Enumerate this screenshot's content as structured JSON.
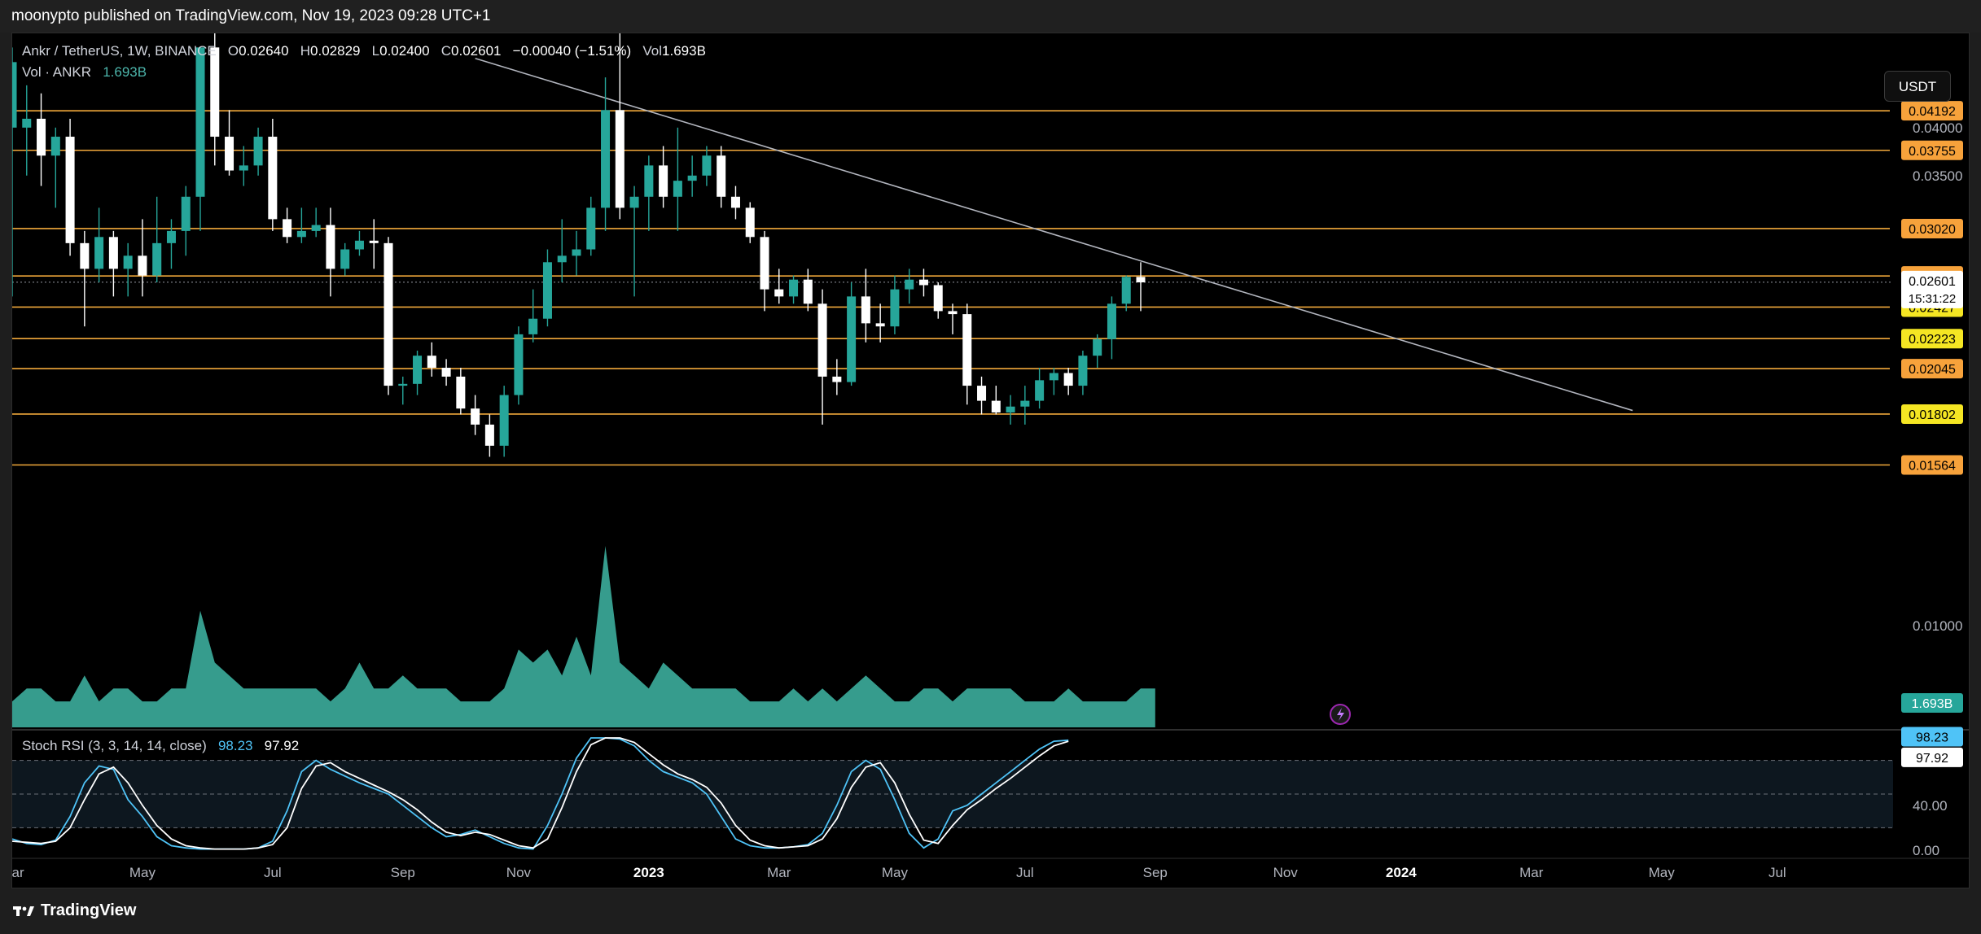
{
  "header": {
    "published_text": "moonypto published on TradingView.com, Nov 19, 2023 09:28 UTC+1"
  },
  "legend": {
    "symbol": "Ankr / TetherUS, 1W, BINANCE",
    "o_label": "O",
    "o_value": "0.02640",
    "h_label": "H",
    "h_value": "0.02829",
    "l_label": "L",
    "l_value": "0.02400",
    "c_label": "C",
    "c_value": "0.02601",
    "change": "−0.00040 (−1.51%)",
    "vol_label": "Vol",
    "vol_value": "1.693B",
    "vol_series_label": "Vol · ANKR",
    "vol_series_value": "1.693B",
    "stoch_label": "Stoch RSI (3, 3, 14, 14, close)",
    "stoch_k": "98.23",
    "stoch_d": "97.92"
  },
  "unit_button": "USDT",
  "footer": {
    "brand": "TradingView"
  },
  "colors": {
    "up": "#26a69a",
    "down": "#ffffff",
    "level_line": "#f2a93b",
    "label_orange": "#f7a23b",
    "label_yellow": "#f5e623",
    "trendline": "#b2b5be",
    "stoch_k": "#4fc3f7",
    "stoch_d": "#ffffff",
    "background": "#000000"
  },
  "chart_data": [
    {
      "type": "candlestick",
      "title": "Ankr / TetherUS, 1W, BINANCE",
      "y_scale": "log",
      "ylim": [
        0.0075,
        0.052
      ],
      "x_range_weeks": [
        -44,
        86
      ],
      "time_axis_labels": [
        "Mar",
        "May",
        "Jul",
        "Sep",
        "Nov",
        "2023",
        "Mar",
        "May",
        "Jul",
        "Sep",
        "Nov",
        "2024",
        "Mar",
        "May",
        "Jul"
      ],
      "time_axis_label_week": [
        -44,
        -35,
        -26,
        -17,
        -9,
        0,
        9,
        17,
        26,
        35,
        44,
        52,
        61,
        70,
        78
      ],
      "price_tick_labels": [
        "0.04000",
        "0.03500",
        "0.01000"
      ],
      "price_tick_values": [
        0.04,
        0.035,
        0.01
      ],
      "last_price": "0.02601",
      "countdown": "15:31:22",
      "horizontal_levels": [
        {
          "value": 0.04192,
          "label": "0.04192",
          "style": "orange"
        },
        {
          "value": 0.03755,
          "label": "0.03755",
          "style": "orange"
        },
        {
          "value": 0.0302,
          "label": "0.03020",
          "style": "orange"
        },
        {
          "value": 0.02647,
          "label": "0.02647",
          "style": "orange"
        },
        {
          "value": 0.02427,
          "label": "0.02427",
          "style": "yellow"
        },
        {
          "value": 0.02223,
          "label": "0.02223",
          "style": "yellow"
        },
        {
          "value": 0.02045,
          "label": "0.02045",
          "style": "orange"
        },
        {
          "value": 0.01802,
          "label": "0.01802",
          "style": "yellow"
        },
        {
          "value": 0.01564,
          "label": "0.01564",
          "style": "orange"
        }
      ],
      "trendline": {
        "from": {
          "week": -12,
          "price": 0.0485
        },
        "to": {
          "week": 68,
          "price": 0.0182
        }
      },
      "candles": [
        {
          "w": -44,
          "o": 0.04,
          "h": 0.05,
          "l": 0.025,
          "c": 0.048
        },
        {
          "w": -43,
          "o": 0.04,
          "h": 0.045,
          "l": 0.035,
          "c": 0.041
        },
        {
          "w": -42,
          "o": 0.041,
          "h": 0.044,
          "l": 0.034,
          "c": 0.037
        },
        {
          "w": -41,
          "o": 0.037,
          "h": 0.04,
          "l": 0.032,
          "c": 0.039
        },
        {
          "w": -40,
          "o": 0.039,
          "h": 0.041,
          "l": 0.028,
          "c": 0.029
        },
        {
          "w": -39,
          "o": 0.029,
          "h": 0.03,
          "l": 0.023,
          "c": 0.027
        },
        {
          "w": -38,
          "o": 0.027,
          "h": 0.032,
          "l": 0.026,
          "c": 0.0295
        },
        {
          "w": -37,
          "o": 0.0295,
          "h": 0.03,
          "l": 0.025,
          "c": 0.027
        },
        {
          "w": -36,
          "o": 0.027,
          "h": 0.029,
          "l": 0.025,
          "c": 0.028
        },
        {
          "w": -35,
          "o": 0.028,
          "h": 0.031,
          "l": 0.025,
          "c": 0.0265
        },
        {
          "w": -34,
          "o": 0.0265,
          "h": 0.033,
          "l": 0.026,
          "c": 0.029
        },
        {
          "w": -33,
          "o": 0.029,
          "h": 0.031,
          "l": 0.027,
          "c": 0.03
        },
        {
          "w": -32,
          "o": 0.03,
          "h": 0.034,
          "l": 0.028,
          "c": 0.033
        },
        {
          "w": -31,
          "o": 0.033,
          "h": 0.05,
          "l": 0.03,
          "c": 0.05
        },
        {
          "w": -30,
          "o": 0.05,
          "h": 0.052,
          "l": 0.036,
          "c": 0.039
        },
        {
          "w": -29,
          "o": 0.039,
          "h": 0.042,
          "l": 0.035,
          "c": 0.0355
        },
        {
          "w": -28,
          "o": 0.0355,
          "h": 0.038,
          "l": 0.034,
          "c": 0.036
        },
        {
          "w": -27,
          "o": 0.036,
          "h": 0.04,
          "l": 0.035,
          "c": 0.039
        },
        {
          "w": -26,
          "o": 0.039,
          "h": 0.041,
          "l": 0.03,
          "c": 0.031
        },
        {
          "w": -25,
          "o": 0.031,
          "h": 0.032,
          "l": 0.029,
          "c": 0.0295
        },
        {
          "w": -24,
          "o": 0.0295,
          "h": 0.032,
          "l": 0.029,
          "c": 0.03
        },
        {
          "w": -23,
          "o": 0.03,
          "h": 0.032,
          "l": 0.0295,
          "c": 0.0305
        },
        {
          "w": -22,
          "o": 0.0305,
          "h": 0.032,
          "l": 0.025,
          "c": 0.027
        },
        {
          "w": -21,
          "o": 0.027,
          "h": 0.029,
          "l": 0.0265,
          "c": 0.0285
        },
        {
          "w": -20,
          "o": 0.0285,
          "h": 0.03,
          "l": 0.028,
          "c": 0.0292
        },
        {
          "w": -19,
          "o": 0.0292,
          "h": 0.031,
          "l": 0.027,
          "c": 0.029
        },
        {
          "w": -18,
          "o": 0.029,
          "h": 0.0295,
          "l": 0.019,
          "c": 0.0195
        },
        {
          "w": -17,
          "o": 0.0195,
          "h": 0.02,
          "l": 0.0185,
          "c": 0.0196
        },
        {
          "w": -16,
          "o": 0.0196,
          "h": 0.0215,
          "l": 0.019,
          "c": 0.0212
        },
        {
          "w": -15,
          "o": 0.0212,
          "h": 0.022,
          "l": 0.02,
          "c": 0.0205
        },
        {
          "w": -14,
          "o": 0.0205,
          "h": 0.021,
          "l": 0.0195,
          "c": 0.02
        },
        {
          "w": -13,
          "o": 0.02,
          "h": 0.0205,
          "l": 0.018,
          "c": 0.0183
        },
        {
          "w": -12,
          "o": 0.0183,
          "h": 0.019,
          "l": 0.017,
          "c": 0.0175
        },
        {
          "w": -11,
          "o": 0.0175,
          "h": 0.018,
          "l": 0.016,
          "c": 0.0165
        },
        {
          "w": -10,
          "o": 0.0165,
          "h": 0.0195,
          "l": 0.016,
          "c": 0.019
        },
        {
          "w": -9,
          "o": 0.019,
          "h": 0.023,
          "l": 0.0185,
          "c": 0.0225
        },
        {
          "w": -8,
          "o": 0.0225,
          "h": 0.0255,
          "l": 0.022,
          "c": 0.0235
        },
        {
          "w": -7,
          "o": 0.0235,
          "h": 0.0285,
          "l": 0.023,
          "c": 0.0275
        },
        {
          "w": -6,
          "o": 0.0275,
          "h": 0.031,
          "l": 0.026,
          "c": 0.028
        },
        {
          "w": -5,
          "o": 0.028,
          "h": 0.03,
          "l": 0.0265,
          "c": 0.0285
        },
        {
          "w": -4,
          "o": 0.0285,
          "h": 0.033,
          "l": 0.028,
          "c": 0.032
        },
        {
          "w": -3,
          "o": 0.032,
          "h": 0.046,
          "l": 0.03,
          "c": 0.042
        },
        {
          "w": -2,
          "o": 0.042,
          "h": 0.052,
          "l": 0.031,
          "c": 0.032
        },
        {
          "w": -1,
          "o": 0.032,
          "h": 0.034,
          "l": 0.025,
          "c": 0.033
        },
        {
          "w": 0,
          "o": 0.033,
          "h": 0.037,
          "l": 0.03,
          "c": 0.036
        },
        {
          "w": 1,
          "o": 0.036,
          "h": 0.038,
          "l": 0.032,
          "c": 0.033
        },
        {
          "w": 2,
          "o": 0.033,
          "h": 0.04,
          "l": 0.03,
          "c": 0.0345
        },
        {
          "w": 3,
          "o": 0.0345,
          "h": 0.037,
          "l": 0.033,
          "c": 0.035
        },
        {
          "w": 4,
          "o": 0.035,
          "h": 0.038,
          "l": 0.034,
          "c": 0.037
        },
        {
          "w": 5,
          "o": 0.037,
          "h": 0.038,
          "l": 0.032,
          "c": 0.033
        },
        {
          "w": 6,
          "o": 0.033,
          "h": 0.034,
          "l": 0.031,
          "c": 0.032
        },
        {
          "w": 7,
          "o": 0.032,
          "h": 0.0325,
          "l": 0.029,
          "c": 0.0295
        },
        {
          "w": 8,
          "o": 0.0295,
          "h": 0.03,
          "l": 0.024,
          "c": 0.0255
        },
        {
          "w": 9,
          "o": 0.0255,
          "h": 0.027,
          "l": 0.0245,
          "c": 0.025
        },
        {
          "w": 10,
          "o": 0.025,
          "h": 0.0265,
          "l": 0.0245,
          "c": 0.0262
        },
        {
          "w": 11,
          "o": 0.0262,
          "h": 0.027,
          "l": 0.024,
          "c": 0.0245
        },
        {
          "w": 12,
          "o": 0.0245,
          "h": 0.0255,
          "l": 0.0175,
          "c": 0.02
        },
        {
          "w": 13,
          "o": 0.02,
          "h": 0.021,
          "l": 0.019,
          "c": 0.0197
        },
        {
          "w": 14,
          "o": 0.0197,
          "h": 0.026,
          "l": 0.0195,
          "c": 0.025
        },
        {
          "w": 15,
          "o": 0.025,
          "h": 0.027,
          "l": 0.022,
          "c": 0.0232
        },
        {
          "w": 16,
          "o": 0.0232,
          "h": 0.0245,
          "l": 0.022,
          "c": 0.023
        },
        {
          "w": 17,
          "o": 0.023,
          "h": 0.0265,
          "l": 0.0225,
          "c": 0.0255
        },
        {
          "w": 18,
          "o": 0.0255,
          "h": 0.027,
          "l": 0.0245,
          "c": 0.0262
        },
        {
          "w": 19,
          "o": 0.0262,
          "h": 0.027,
          "l": 0.025,
          "c": 0.0258
        },
        {
          "w": 20,
          "o": 0.0258,
          "h": 0.026,
          "l": 0.0235,
          "c": 0.024
        },
        {
          "w": 21,
          "o": 0.024,
          "h": 0.0245,
          "l": 0.0225,
          "c": 0.0238
        },
        {
          "w": 22,
          "o": 0.0238,
          "h": 0.0245,
          "l": 0.0185,
          "c": 0.0195
        },
        {
          "w": 23,
          "o": 0.0195,
          "h": 0.02,
          "l": 0.018,
          "c": 0.0187
        },
        {
          "w": 24,
          "o": 0.0187,
          "h": 0.0195,
          "l": 0.018,
          "c": 0.0181
        },
        {
          "w": 25,
          "o": 0.0181,
          "h": 0.019,
          "l": 0.0175,
          "c": 0.0184
        },
        {
          "w": 26,
          "o": 0.0184,
          "h": 0.0195,
          "l": 0.0175,
          "c": 0.0187
        },
        {
          "w": 27,
          "o": 0.0187,
          "h": 0.0205,
          "l": 0.0183,
          "c": 0.0198
        },
        {
          "w": 28,
          "o": 0.0198,
          "h": 0.0205,
          "l": 0.019,
          "c": 0.0202
        },
        {
          "w": 29,
          "o": 0.0202,
          "h": 0.0205,
          "l": 0.019,
          "c": 0.0195
        },
        {
          "w": 30,
          "o": 0.0195,
          "h": 0.0215,
          "l": 0.019,
          "c": 0.0212
        },
        {
          "w": 31,
          "o": 0.0212,
          "h": 0.0225,
          "l": 0.0205,
          "c": 0.0222
        },
        {
          "w": 32,
          "o": 0.0222,
          "h": 0.025,
          "l": 0.021,
          "c": 0.0245
        },
        {
          "w": 33,
          "o": 0.0245,
          "h": 0.0265,
          "l": 0.024,
          "c": 0.0264
        },
        {
          "w": 34,
          "o": 0.0264,
          "h": 0.0275,
          "l": 0.024,
          "c": 0.026
        }
      ],
      "volume": {
        "label": "Vol · ANKR",
        "last": "1.693B",
        "values": [
          2,
          3,
          3,
          2,
          2,
          4,
          2,
          3,
          3,
          2,
          2,
          3,
          3,
          9,
          5,
          4,
          3,
          3,
          3,
          3,
          3,
          3,
          2,
          3,
          5,
          3,
          3,
          4,
          3,
          3,
          3,
          2,
          2,
          2,
          3,
          6,
          5,
          6,
          4,
          7,
          4,
          14,
          5,
          4,
          3,
          5,
          4,
          3,
          3,
          3,
          3,
          2,
          2,
          2,
          3,
          2,
          3,
          2,
          3,
          4,
          3,
          2,
          2,
          3,
          3,
          2,
          3,
          3,
          3,
          3,
          2,
          2,
          2,
          3,
          2,
          2,
          2,
          2,
          3,
          3
        ]
      },
      "stoch_rsi": {
        "label": "Stoch RSI (3, 3, 14, 14, close)",
        "k_last": "98.23",
        "d_last": "97.92",
        "axis_labels": [
          "40.00",
          "0.00"
        ],
        "bands": [
          80,
          50,
          20
        ],
        "k": [
          10,
          6,
          5,
          9,
          30,
          60,
          75,
          72,
          45,
          30,
          12,
          4,
          2,
          1,
          1,
          1,
          1,
          2,
          8,
          35,
          70,
          80,
          72,
          66,
          60,
          55,
          50,
          40,
          30,
          20,
          12,
          14,
          18,
          12,
          6,
          2,
          1,
          22,
          50,
          82,
          100,
          100,
          99,
          93,
          80,
          70,
          65,
          60,
          50,
          30,
          10,
          4,
          2,
          2,
          3,
          5,
          15,
          40,
          70,
          80,
          72,
          45,
          15,
          2,
          10,
          35,
          40,
          50,
          60,
          70,
          80,
          90,
          97,
          98
        ],
        "d": [
          8,
          7,
          6,
          8,
          20,
          45,
          68,
          74,
          60,
          40,
          22,
          10,
          4,
          2,
          1,
          1,
          1,
          2,
          5,
          20,
          55,
          75,
          78,
          70,
          64,
          58,
          52,
          45,
          36,
          25,
          16,
          13,
          16,
          14,
          9,
          4,
          2,
          10,
          38,
          70,
          94,
          100,
          100,
          96,
          86,
          76,
          68,
          63,
          56,
          42,
          22,
          9,
          4,
          2,
          3,
          4,
          10,
          28,
          56,
          74,
          78,
          60,
          32,
          9,
          6,
          22,
          36,
          45,
          55,
          64,
          74,
          84,
          93,
          97
        ]
      }
    }
  ]
}
